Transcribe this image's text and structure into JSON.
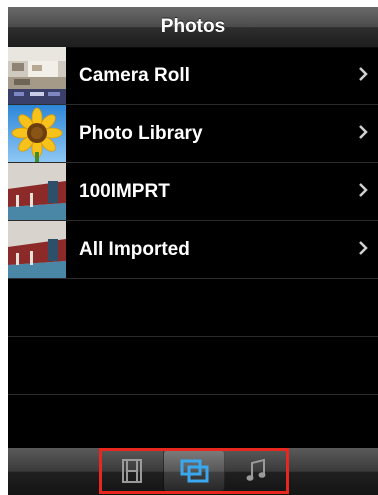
{
  "navbar": {
    "title": "Photos"
  },
  "albums": [
    {
      "label": "Camera Roll",
      "thumb_icon": "camera-roll-thumbnail"
    },
    {
      "label": "Photo Library",
      "thumb_icon": "sunflower-thumbnail"
    },
    {
      "label": "100IMPRT",
      "thumb_icon": "room-photo-thumbnail"
    },
    {
      "label": "All Imported",
      "thumb_icon": "room-photo-thumbnail"
    }
  ],
  "tabbar": {
    "tabs": [
      {
        "icon": "film-icon",
        "selected": false
      },
      {
        "icon": "photos-icon",
        "selected": true
      },
      {
        "icon": "music-note-icon",
        "selected": false
      }
    ],
    "highlight_color": "#e8271f",
    "selected_color": "#3aa8ee"
  }
}
